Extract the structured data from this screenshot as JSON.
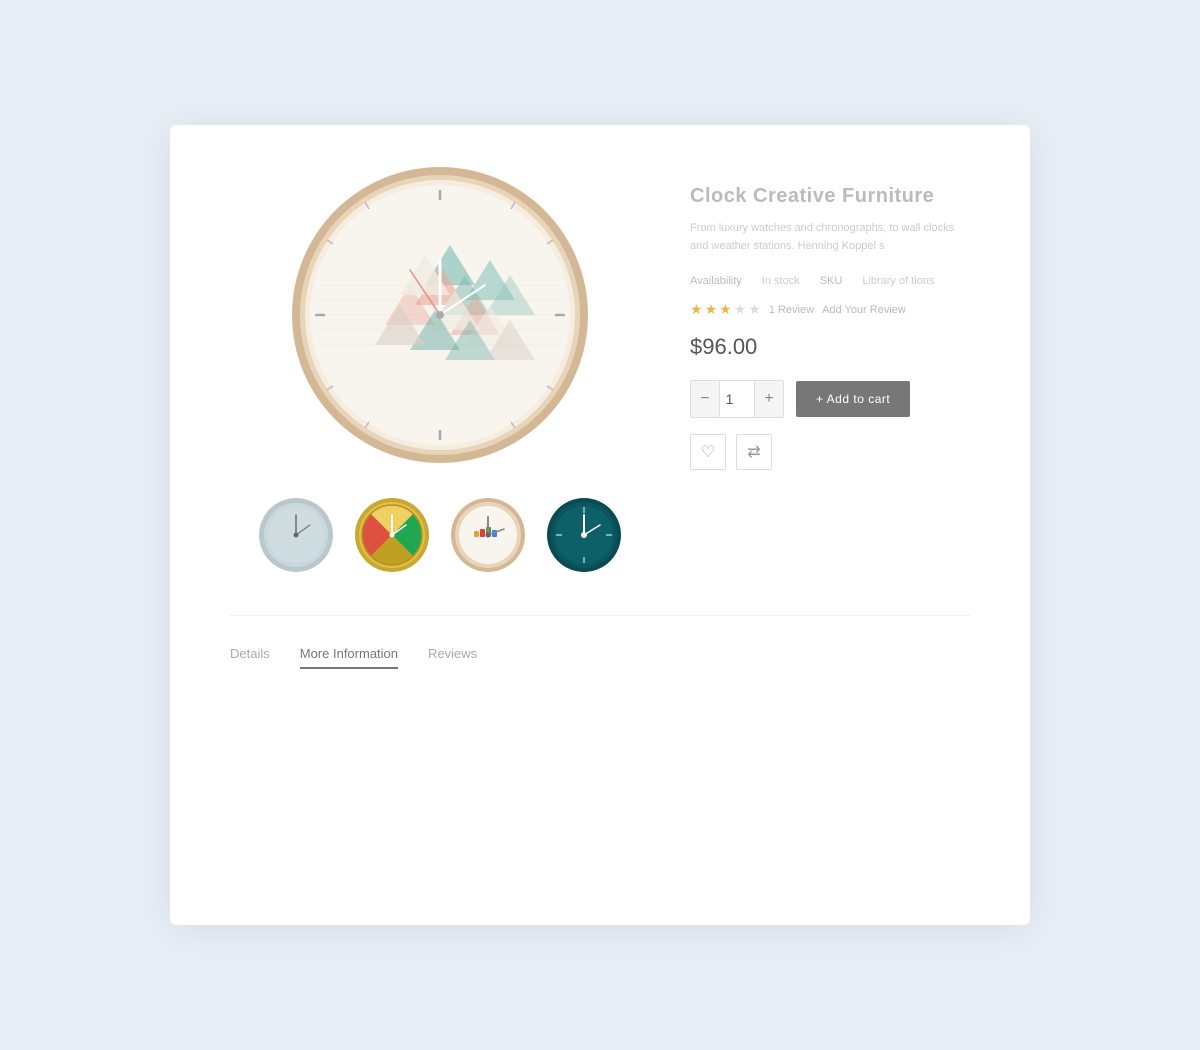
{
  "product": {
    "title": "Clock Creative Furniture",
    "description": "From luxury watches and chronographs, to wall clocks and weather stations. Henning Koppel s",
    "availability_label": "Availability",
    "availability_value": "In stock",
    "sku_label": "SKU",
    "sku_value": "Library of tions",
    "rating": 3.5,
    "rating_count": "1 Review",
    "add_review_label": "Add Your Review",
    "price": "$96.00",
    "quantity": 1,
    "add_to_cart_label": "+ Add to cart"
  },
  "tabs": [
    {
      "id": "details",
      "label": "Details",
      "active": false
    },
    {
      "id": "more-info",
      "label": "More Information",
      "active": true
    },
    {
      "id": "reviews",
      "label": "Reviews",
      "active": false
    }
  ],
  "thumbnails": [
    {
      "id": "thumb-1",
      "style": "grey"
    },
    {
      "id": "thumb-2",
      "style": "colorful"
    },
    {
      "id": "thumb-3",
      "style": "white-birds"
    },
    {
      "id": "thumb-4",
      "style": "teal"
    }
  ],
  "icons": {
    "wishlist": "♡",
    "compare": "⇄",
    "minus": "−",
    "plus": "+"
  }
}
